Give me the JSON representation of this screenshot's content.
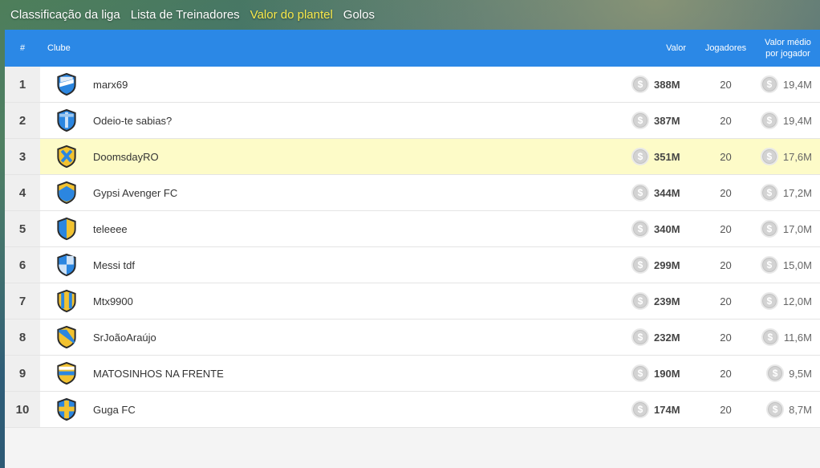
{
  "tabs": [
    {
      "label": "Classificação da liga",
      "active": false
    },
    {
      "label": "Lista de Treinadores",
      "active": false
    },
    {
      "label": "Valor do plantel",
      "active": true
    },
    {
      "label": "Golos",
      "active": false
    }
  ],
  "table": {
    "headers": {
      "rank": "#",
      "club": "Clube",
      "value": "Valor",
      "players": "Jogadores",
      "avg_line1": "Valor médio",
      "avg_line2": "por jogador"
    },
    "rows": [
      {
        "rank": "1",
        "club": "marx69",
        "value": "388M",
        "players": "20",
        "avg": "19,4M",
        "badge": "white-stripe-shield-icon",
        "highlight": false
      },
      {
        "rank": "2",
        "club": "Odeio-te sabias?",
        "value": "387M",
        "players": "20",
        "avg": "19,4M",
        "badge": "blue-shield-icon",
        "highlight": false
      },
      {
        "rank": "3",
        "club": "DoomsdayRO",
        "value": "351M",
        "players": "20",
        "avg": "17,6M",
        "badge": "yellow-cross-shield-icon",
        "highlight": true
      },
      {
        "rank": "4",
        "club": "Gypsi Avenger FC",
        "value": "344M",
        "players": "20",
        "avg": "17,2M",
        "badge": "yellow-chevron-shield-icon",
        "highlight": false
      },
      {
        "rank": "5",
        "club": "teleeee",
        "value": "340M",
        "players": "20",
        "avg": "17,0M",
        "badge": "half-blue-yellow-shield-icon",
        "highlight": false
      },
      {
        "rank": "6",
        "club": "Messi tdf",
        "value": "299M",
        "players": "20",
        "avg": "15,0M",
        "badge": "quartered-blue-shield-icon",
        "highlight": false
      },
      {
        "rank": "7",
        "club": "Mtx9900",
        "value": "239M",
        "players": "20",
        "avg": "12,0M",
        "badge": "striped-yellow-shield-icon",
        "highlight": false
      },
      {
        "rank": "8",
        "club": "SrJoãoAraújo",
        "value": "232M",
        "players": "20",
        "avg": "11,6M",
        "badge": "diagonal-yellow-shield-icon",
        "highlight": false
      },
      {
        "rank": "9",
        "club": "MATOSINHOS NA FRENTE",
        "value": "190M",
        "players": "20",
        "avg": "9,5M",
        "badge": "horizontal-stripe-shield-icon",
        "highlight": false
      },
      {
        "rank": "10",
        "club": "Guga FC",
        "value": "174M",
        "players": "20",
        "avg": "8,7M",
        "badge": "cross-blue-yellow-shield-icon",
        "highlight": false
      }
    ]
  },
  "coin_symbol": "$",
  "colors": {
    "header_bg": "#2b88e6",
    "active_tab": "#f7e84a",
    "highlight_row": "#fdfbc8",
    "badge_blue": "#2b86e0",
    "badge_yellow": "#f2c230",
    "badge_outline": "#2a2a2a"
  }
}
